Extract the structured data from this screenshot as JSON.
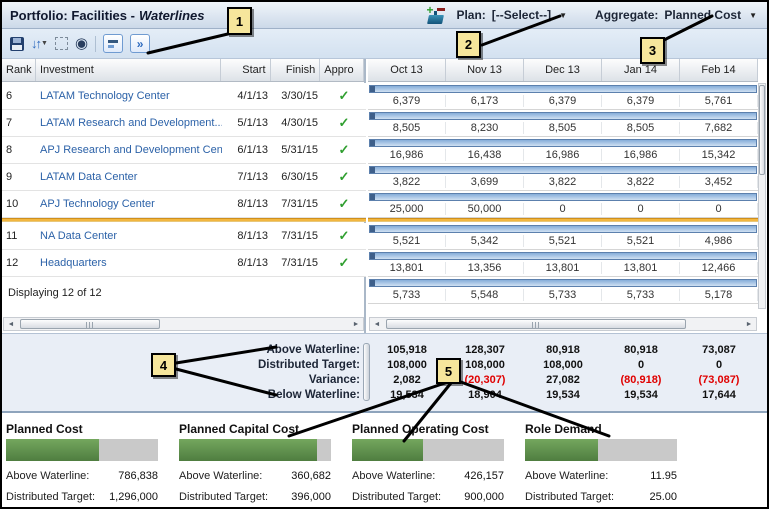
{
  "header": {
    "title_prefix": "Portfolio: Facilities -",
    "title_italic": "Waterlines",
    "plan_label": "Plan:",
    "plan_value": "[--Select--]",
    "aggregate_label": "Aggregate:",
    "aggregate_value": "Planned Cost"
  },
  "glyphs": {
    "check": "✓",
    "dropdown": "▼",
    "sort": "↓↑",
    "caret": "▼",
    "eye": "◉",
    "expand": "»",
    "scroll_left": "◄",
    "scroll_right": "►"
  },
  "left_table": {
    "columns": {
      "rank": "Rank",
      "investment": "Investment",
      "start": "Start",
      "finish": "Finish",
      "approved": "Appro"
    },
    "rows": [
      {
        "rank": "6",
        "investment": "LATAM Technology Center",
        "start": "4/1/13",
        "finish": "3/30/15"
      },
      {
        "rank": "7",
        "investment": "LATAM Research and Development...",
        "start": "5/1/13",
        "finish": "4/30/15"
      },
      {
        "rank": "8",
        "investment": "APJ Research and Development Center",
        "start": "6/1/13",
        "finish": "5/31/15"
      },
      {
        "rank": "9",
        "investment": "LATAM Data Center",
        "start": "7/1/13",
        "finish": "6/30/15"
      },
      {
        "rank": "10",
        "investment": "APJ Technology Center",
        "start": "8/1/13",
        "finish": "7/31/15"
      },
      {
        "rank": "11",
        "investment": "NA Data Center",
        "start": "8/1/13",
        "finish": "7/31/15"
      },
      {
        "rank": "12",
        "investment": "Headquarters",
        "start": "8/1/13",
        "finish": "7/31/15"
      }
    ],
    "status": "Displaying 12 of 12"
  },
  "timeline": {
    "months": [
      "Oct 13",
      "Nov 13",
      "Dec 13",
      "Jan 14",
      "Feb 14"
    ],
    "waterline_after_row": 5,
    "rows": [
      {
        "values": [
          "6,379",
          "6,173",
          "6,379",
          "6,379",
          "5,761"
        ]
      },
      {
        "values": [
          "8,505",
          "8,230",
          "8,505",
          "8,505",
          "7,682"
        ]
      },
      {
        "values": [
          "16,986",
          "16,438",
          "16,986",
          "16,986",
          "15,342"
        ]
      },
      {
        "values": [
          "3,822",
          "3,699",
          "3,822",
          "3,822",
          "3,452"
        ]
      },
      {
        "values": [
          "25,000",
          "50,000",
          "0",
          "0",
          "0"
        ]
      },
      {
        "values": [
          "5,521",
          "5,342",
          "5,521",
          "5,521",
          "4,986"
        ]
      },
      {
        "values": [
          "13,801",
          "13,356",
          "13,801",
          "13,801",
          "12,466"
        ]
      },
      {
        "values": [
          "5,733",
          "5,548",
          "5,733",
          "5,733",
          "5,178"
        ]
      }
    ]
  },
  "summary": {
    "rows": [
      {
        "label": "Above Waterline:",
        "values": [
          "105,918",
          "128,307",
          "80,918",
          "80,918",
          "73,087"
        ]
      },
      {
        "label": "Distributed Target:",
        "values": [
          "108,000",
          "108,000",
          "108,000",
          "0",
          "0"
        ]
      },
      {
        "label": "Variance:",
        "values": [
          "2,082",
          "(20,307)",
          "27,082",
          "(80,918)",
          "(73,087)"
        ]
      },
      {
        "label": "Below Waterline:",
        "values": [
          "19,534",
          "18,904",
          "19,534",
          "19,534",
          "17,644"
        ]
      }
    ]
  },
  "metrics": [
    {
      "title": "Planned Cost",
      "above_label": "Above Waterline:",
      "above": "786,838",
      "target_label": "Distributed Target:",
      "target": "1,296,000",
      "fill": 61
    },
    {
      "title": "Planned Capital Cost",
      "above_label": "Above Waterline:",
      "above": "360,682",
      "target_label": "Distributed Target:",
      "target": "396,000",
      "fill": 91
    },
    {
      "title": "Planned Operating Cost",
      "above_label": "Above Waterline:",
      "above": "426,157",
      "target_label": "Distributed Target:",
      "target": "900,000",
      "fill": 47
    },
    {
      "title": "Role Demand",
      "above_label": "Above Waterline:",
      "above": "11.95",
      "target_label": "Distributed Target:",
      "target": "25.00",
      "fill": 48
    }
  ],
  "callouts": {
    "c1": "1",
    "c2": "2",
    "c3": "3",
    "c4": "4",
    "c5": "5"
  },
  "colors": {
    "waterline": "#f2b63f",
    "bar_blue": "#86add9",
    "metric_green": "#5a8f4a",
    "negative": "#e00000",
    "investment_link": "#2c62a8",
    "approved_check": "#2f9e2f",
    "callout_bg": "#f6e69c"
  }
}
